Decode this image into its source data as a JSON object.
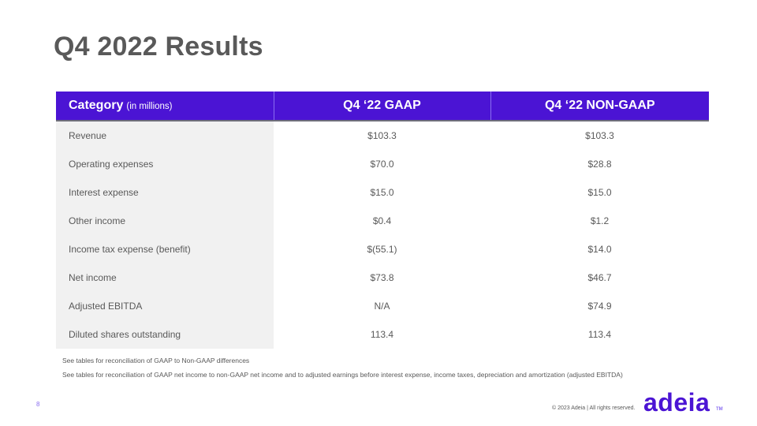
{
  "slide": {
    "title": "Q4 2022 Results",
    "page_number": "8"
  },
  "table": {
    "header": {
      "category_label": "Category",
      "category_sub": "(in millions)",
      "col_gaap": "Q4 ‘22 GAAP",
      "col_nongaap": "Q4 ‘22 NON-GAAP"
    },
    "rows": [
      {
        "label": "Revenue",
        "gaap": "$103.3",
        "nongaap": "$103.3"
      },
      {
        "label": "Operating expenses",
        "gaap": "$70.0",
        "nongaap": "$28.8"
      },
      {
        "label": "Interest expense",
        "gaap": "$15.0",
        "nongaap": "$15.0"
      },
      {
        "label": "Other income",
        "gaap": "$0.4",
        "nongaap": "$1.2"
      },
      {
        "label": "Income tax expense (benefit)",
        "gaap": "$(55.1)",
        "nongaap": "$14.0"
      },
      {
        "label": "Net income",
        "gaap": "$73.8",
        "nongaap": "$46.7"
      },
      {
        "label": "Adjusted EBITDA",
        "gaap": "N/A",
        "nongaap": "$74.9"
      },
      {
        "label": "Diluted shares outstanding",
        "gaap": "113.4",
        "nongaap": "113.4"
      }
    ]
  },
  "footnotes": [
    "See tables for reconciliation of GAAP to Non-GAAP differences",
    "See tables for reconciliation of GAAP net income to non-GAAP net income and to adjusted earnings before interest expense, income taxes, depreciation and amortization (adjusted EBITDA)"
  ],
  "footer": {
    "copyright": "© 2023 Adeia | All rights reserved.",
    "logo_text": "adeia",
    "trademark": "TM"
  },
  "colors": {
    "brand_purple": "#4b14d4",
    "label_bg": "#f1f1f1",
    "text_gray": "#595959"
  }
}
